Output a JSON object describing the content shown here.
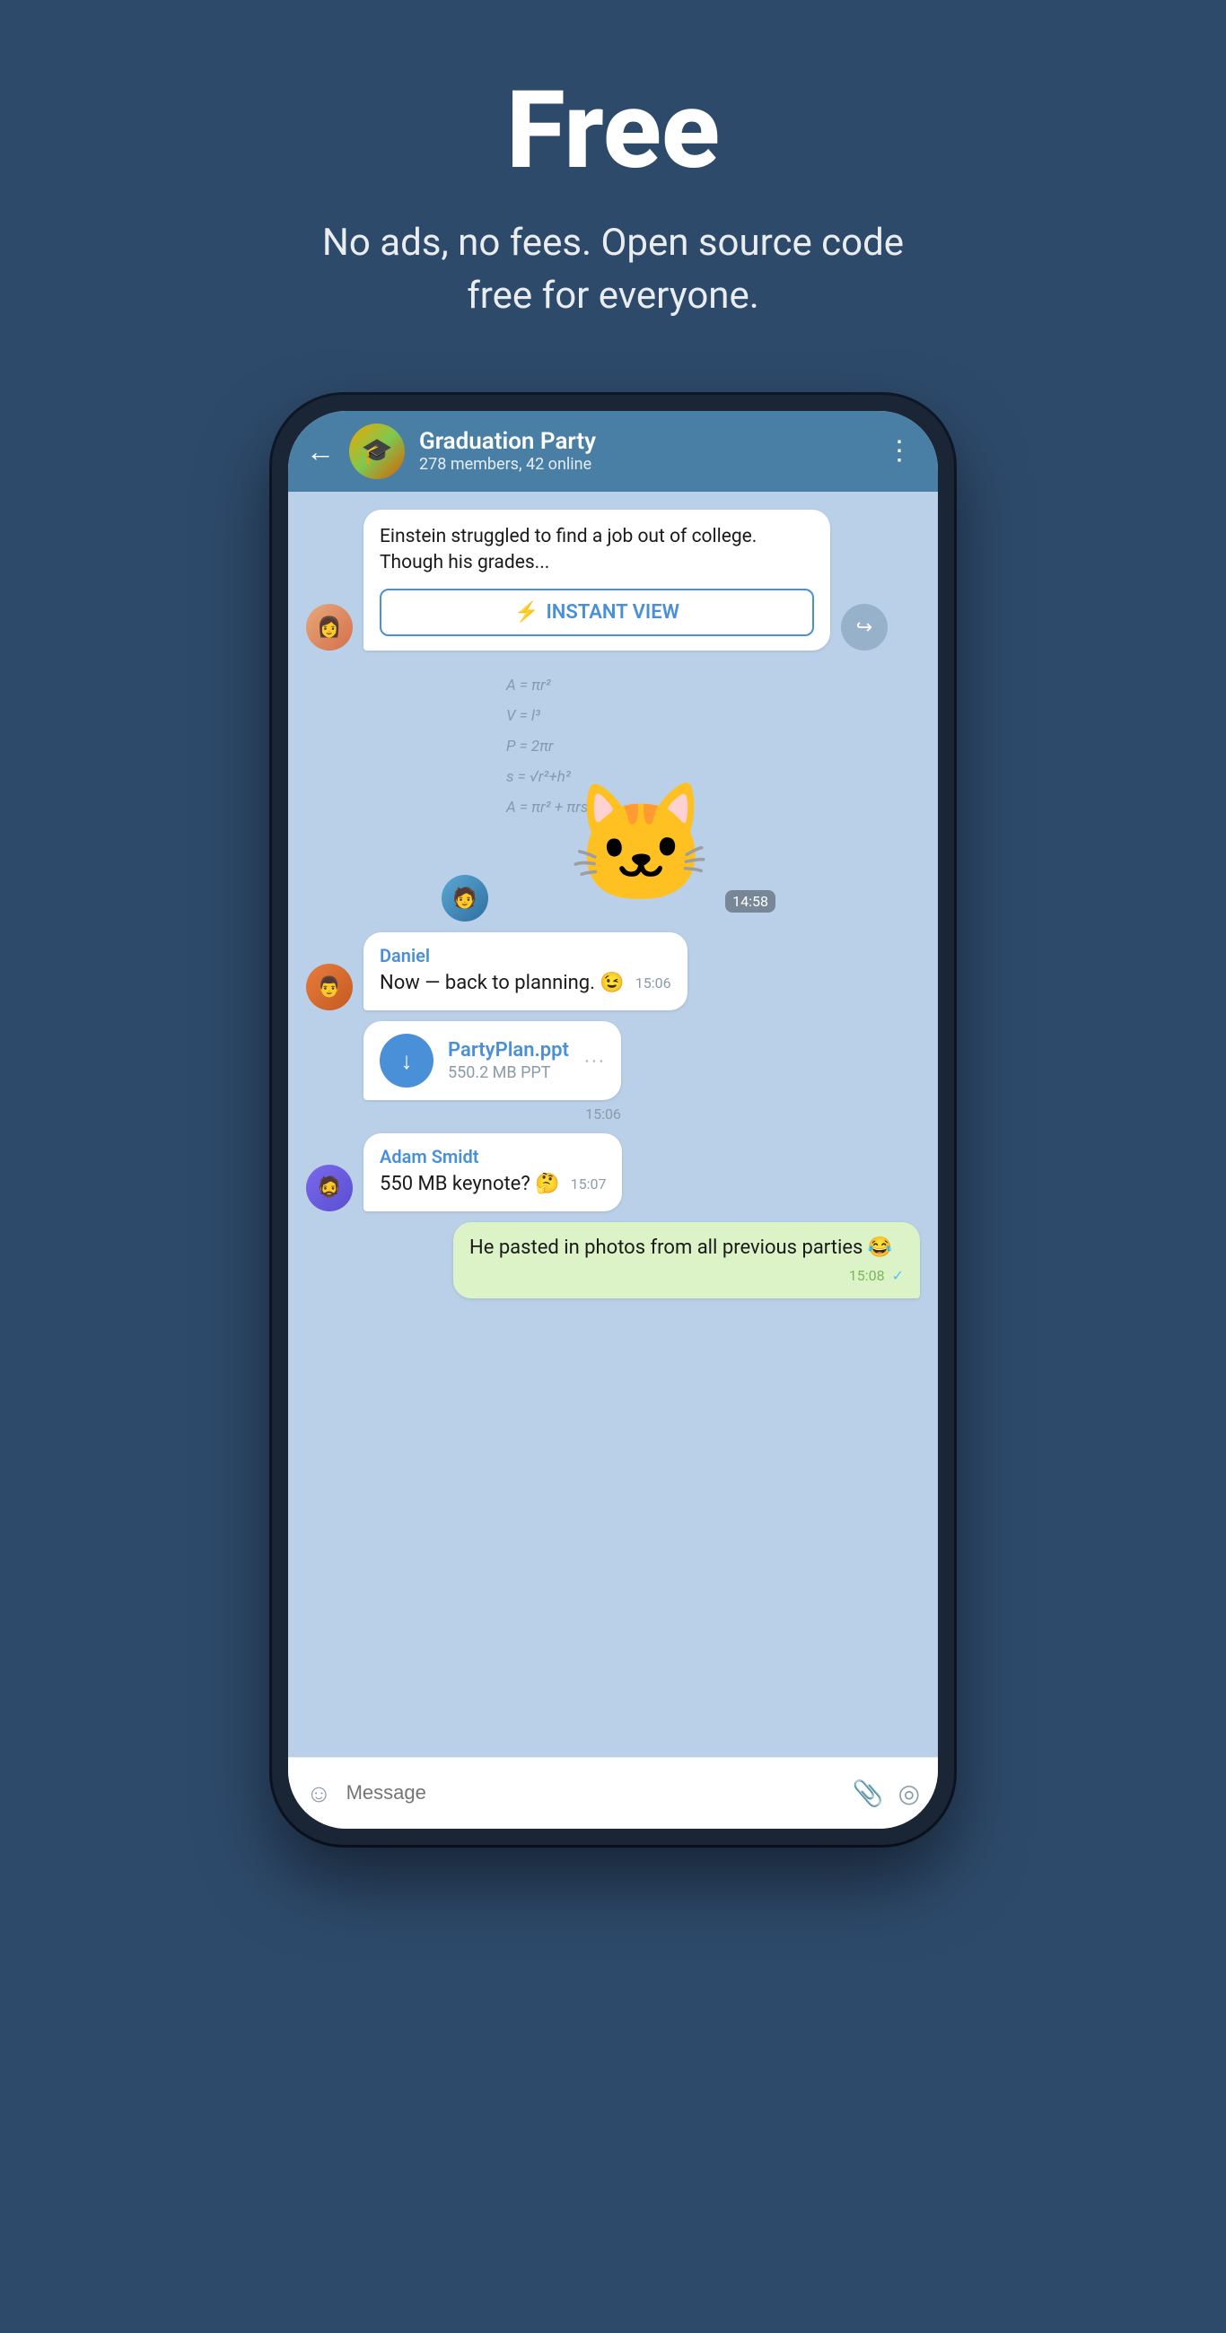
{
  "hero": {
    "title": "Free",
    "subtitle": "No ads, no fees. Open source code free for everyone."
  },
  "phone": {
    "header": {
      "back_label": "←",
      "group_name": "Graduation Party",
      "group_status": "278 members, 42 online",
      "more_icon": "⋮"
    },
    "messages": [
      {
        "id": "iv-message",
        "type": "instant_view",
        "text": "Einstein struggled to find a job out of college. Though his grades...",
        "button_label": "INSTANT VIEW",
        "button_icon": "⚡"
      },
      {
        "id": "sticker-message",
        "type": "sticker",
        "time": "14:58"
      },
      {
        "id": "daniel-message",
        "type": "text",
        "sender": "Daniel",
        "text": "Now — back to planning. 😉",
        "time": "15:06"
      },
      {
        "id": "file-message",
        "type": "file",
        "filename": "PartyPlan.ppt",
        "filesize": "550.2 MB PPT",
        "time": "15:06"
      },
      {
        "id": "adam-message",
        "type": "text",
        "sender": "Adam Smidt",
        "text": "550 MB keynote? 🤔",
        "time": "15:07"
      },
      {
        "id": "own-message",
        "type": "text_own",
        "text": "He pasted in photos from all previous parties 😂",
        "time": "15:08",
        "checkmark": "✓"
      }
    ],
    "input_bar": {
      "placeholder": "Message",
      "emoji_icon": "☺",
      "attach_icon": "📎",
      "camera_icon": "◎"
    }
  }
}
